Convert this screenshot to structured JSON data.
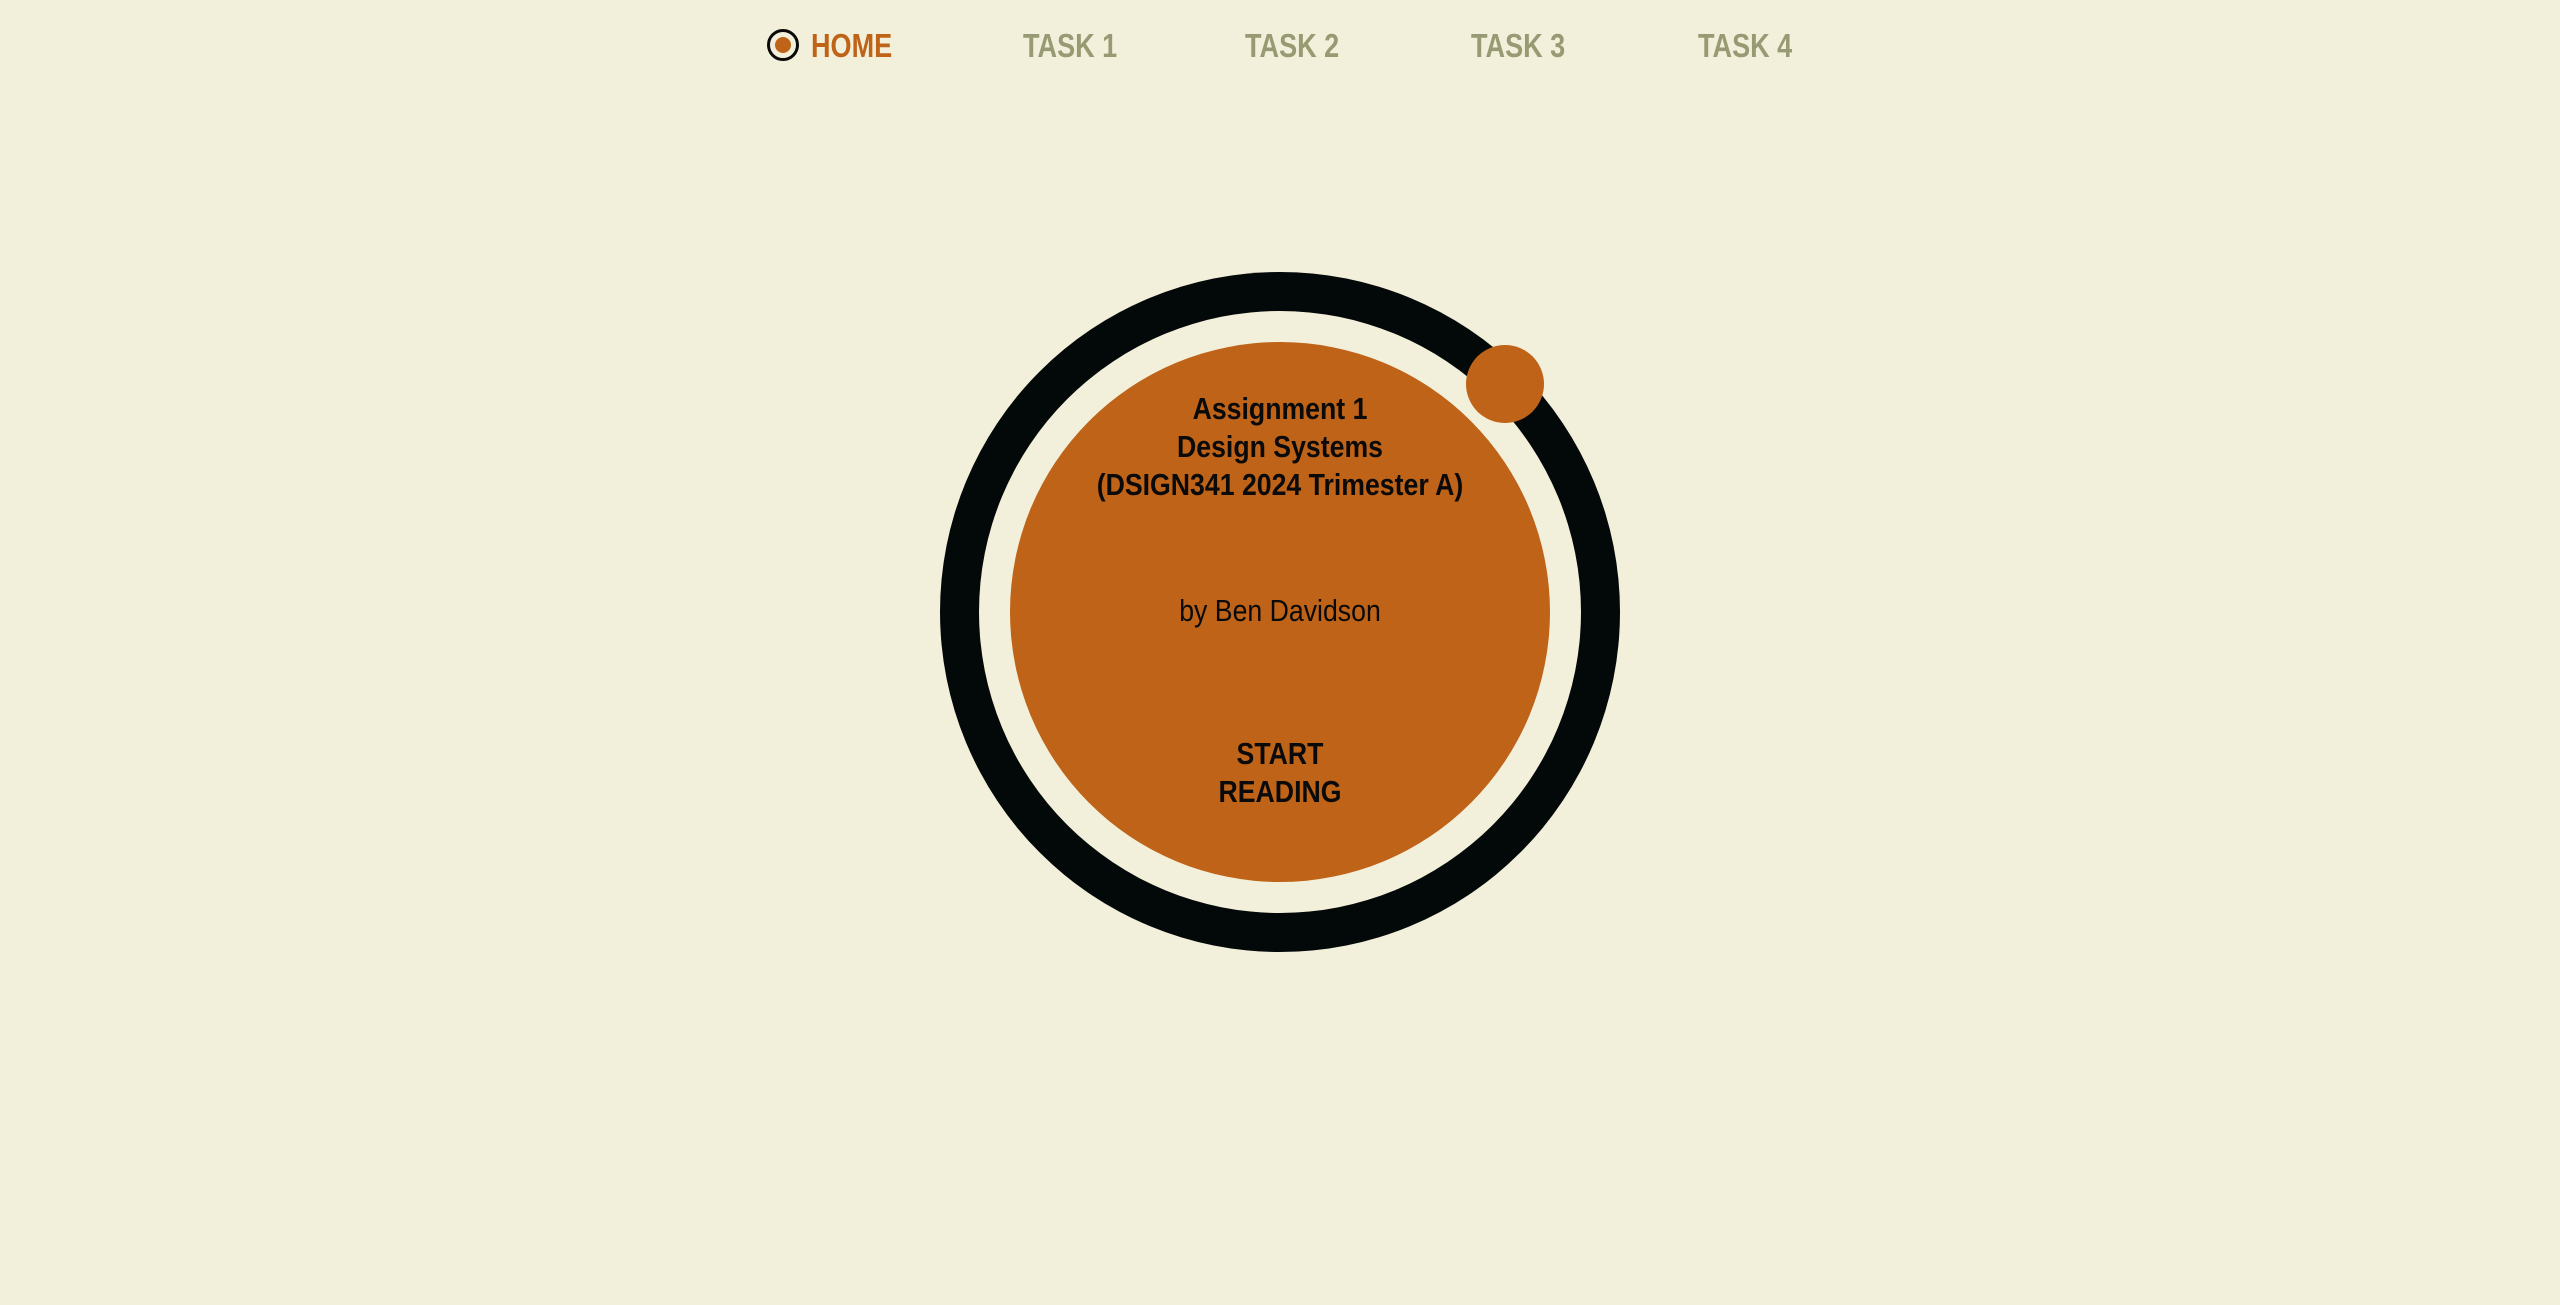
{
  "nav": {
    "items": [
      {
        "label": "HOME",
        "active": true,
        "icon": "target-icon"
      },
      {
        "label": "TASK 1",
        "active": false
      },
      {
        "label": "TASK 2",
        "active": false
      },
      {
        "label": "TASK 3",
        "active": false
      },
      {
        "label": "TASK 4",
        "active": false
      }
    ]
  },
  "hero": {
    "title_line1": "Assignment 1",
    "title_line2": "Design Systems",
    "title_line3": "(DSIGN341 2024 Trimester A)",
    "author": "by Ben Davidson",
    "cta_line1": "START",
    "cta_line2": "READING"
  },
  "colors": {
    "background": "#f2f0da",
    "accent": "#bf6318",
    "ring": "#030808",
    "nav_inactive": "#979a72"
  }
}
